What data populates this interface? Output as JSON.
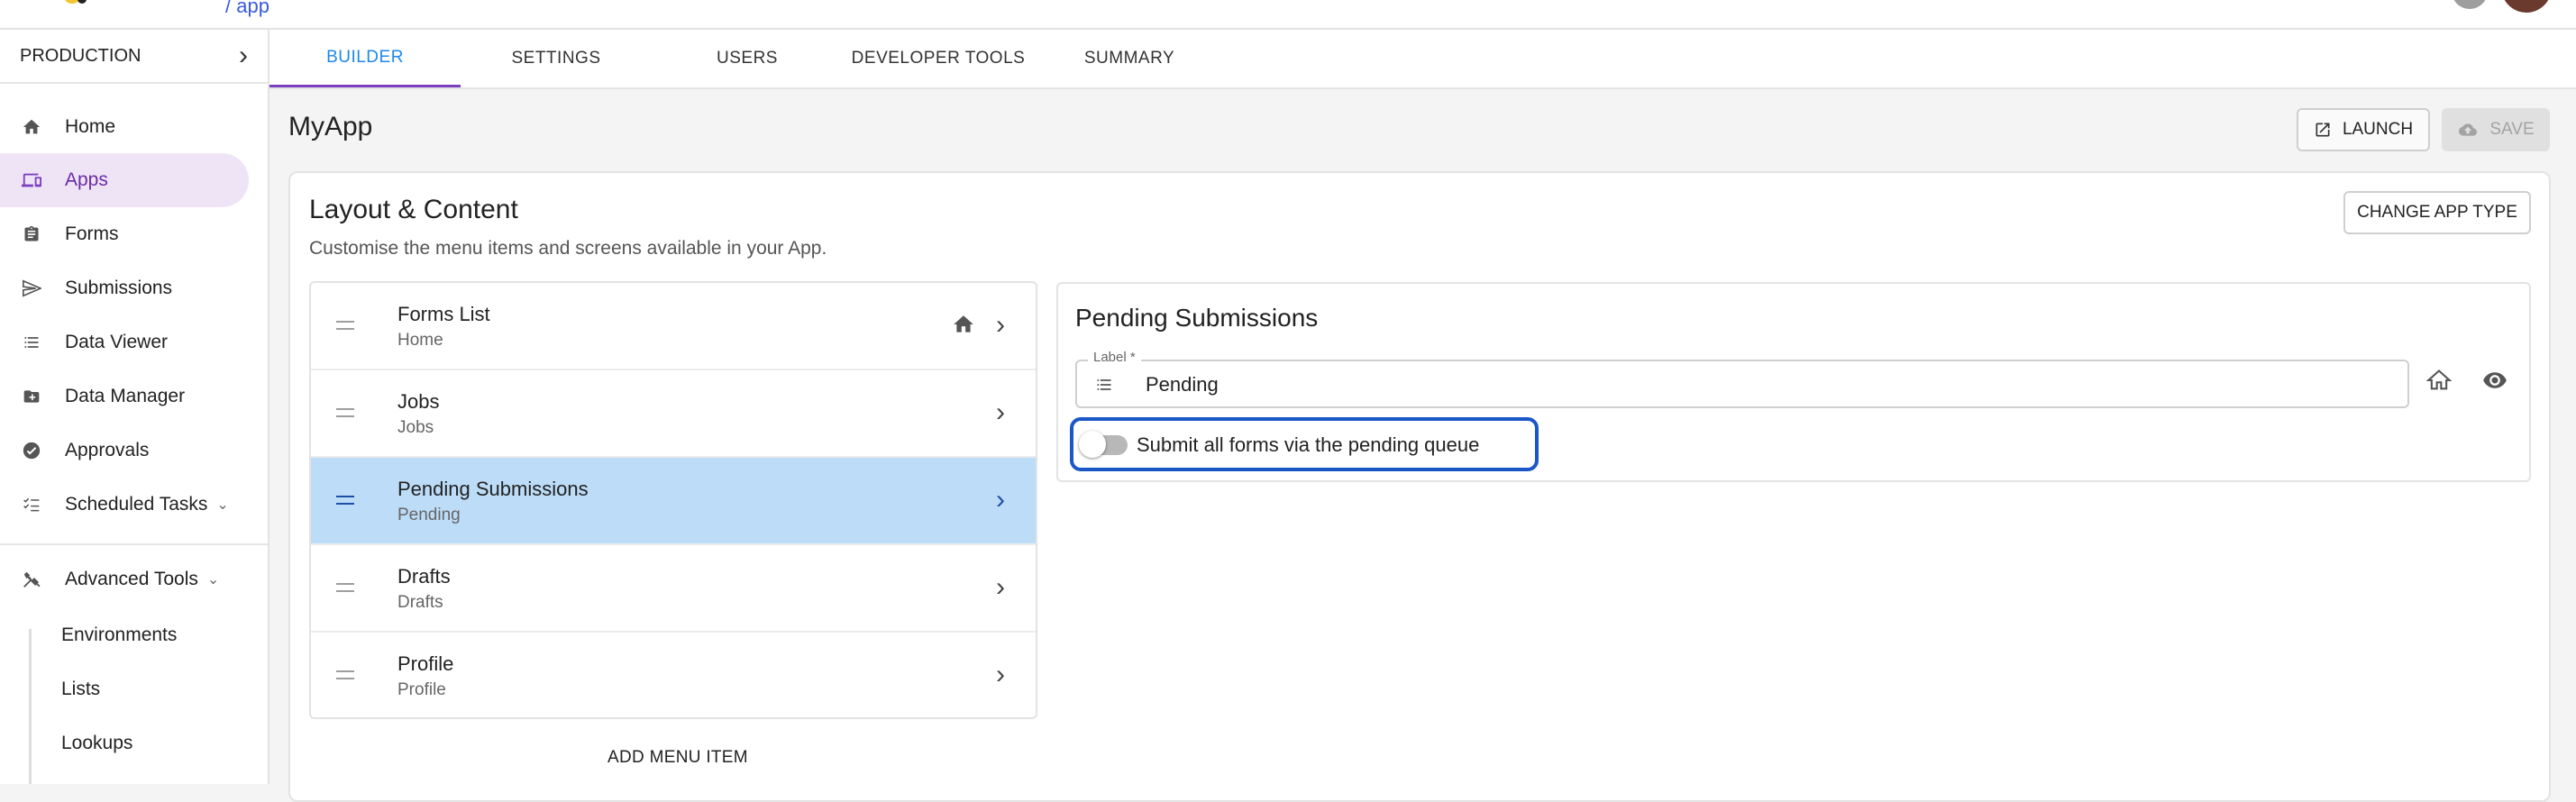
{
  "topbar": {
    "crumb": "/ app"
  },
  "sidebar": {
    "environment": "PRODUCTION",
    "items": [
      {
        "label": "Home",
        "icon": "home-icon"
      },
      {
        "label": "Apps",
        "icon": "devices-icon",
        "active": true
      },
      {
        "label": "Forms",
        "icon": "clipboard-icon"
      },
      {
        "label": "Submissions",
        "icon": "send-icon"
      },
      {
        "label": "Data Viewer",
        "icon": "list-icon"
      },
      {
        "label": "Data Manager",
        "icon": "folder-icon"
      },
      {
        "label": "Approvals",
        "icon": "check-circle-icon"
      },
      {
        "label": "Scheduled Tasks",
        "icon": "checklist-icon"
      },
      {
        "label": "Advanced Tools",
        "icon": "tools-icon"
      }
    ],
    "sub_items": [
      "Environments",
      "Lists",
      "Lookups"
    ]
  },
  "tabs": [
    "BUILDER",
    "SETTINGS",
    "USERS",
    "DEVELOPER TOOLS",
    "SUMMARY"
  ],
  "app": {
    "title": "MyApp",
    "launch_label": "LAUNCH",
    "save_label": "SAVE"
  },
  "layout": {
    "title": "Layout & Content",
    "description": "Customise the menu items and screens available in your App.",
    "change_label": "CHANGE APP TYPE",
    "add_label": "ADD MENU ITEM",
    "menu_items": [
      {
        "label": "Forms List",
        "sub": "Home"
      },
      {
        "label": "Jobs",
        "sub": "Jobs"
      },
      {
        "label": "Pending Submissions",
        "sub": "Pending"
      },
      {
        "label": "Drafts",
        "sub": "Drafts"
      },
      {
        "label": "Profile",
        "sub": "Profile"
      }
    ]
  },
  "detail": {
    "title": "Pending Submissions",
    "field_label": "Label *",
    "field_value": "Pending",
    "toggle_label": "Submit all forms via the pending queue"
  },
  "colors": {
    "accent": "#7b3fbf",
    "tab_active": "#1e88e5",
    "selected_row": "#bcdcf7",
    "highlight_border": "#1a57c7"
  }
}
